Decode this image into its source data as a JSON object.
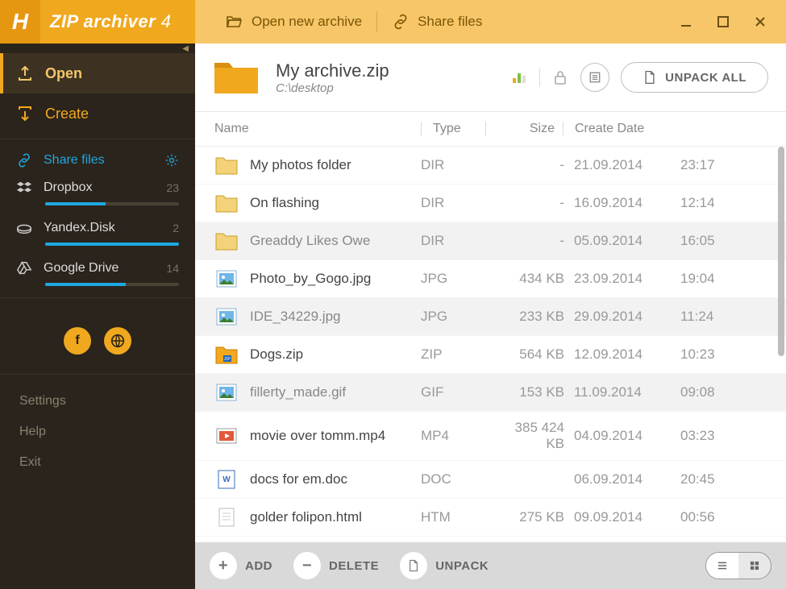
{
  "app": {
    "name": "ZIP archiver",
    "version": "4"
  },
  "toolbar": {
    "open_archive": "Open new archive",
    "share_files": "Share files"
  },
  "sidebar": {
    "open": "Open",
    "create": "Create",
    "share": "Share files",
    "clouds": [
      {
        "name": "Dropbox",
        "count": "23",
        "progress": 45
      },
      {
        "name": "Yandex.Disk",
        "count": "2",
        "progress": 100
      },
      {
        "name": "Google Drive",
        "count": "14",
        "progress": 60
      }
    ],
    "settings": "Settings",
    "help": "Help",
    "exit": "Exit"
  },
  "archive": {
    "name": "My archive.zip",
    "path": "C:\\desktop",
    "unpack_all": "UNPACK ALL"
  },
  "columns": {
    "name": "Name",
    "type": "Type",
    "size": "Size",
    "date": "Create Date"
  },
  "files": [
    {
      "icon": "folder",
      "name": "My photos folder",
      "type": "DIR",
      "size": "-",
      "date": "21.09.2014",
      "time": "23:17",
      "shade": false
    },
    {
      "icon": "folder",
      "name": "On flashing",
      "type": "DIR",
      "size": "-",
      "date": "16.09.2014",
      "time": "12:14",
      "shade": false
    },
    {
      "icon": "folder",
      "name": "Greaddy Likes Owe",
      "type": "DIR",
      "size": "-",
      "date": "05.09.2014",
      "time": "16:05",
      "shade": true
    },
    {
      "icon": "image",
      "name": "Photo_by_Gogo.jpg",
      "type": "JPG",
      "size": "434 KB",
      "date": "23.09.2014",
      "time": "19:04",
      "shade": false
    },
    {
      "icon": "image",
      "name": "IDE_34229.jpg",
      "type": "JPG",
      "size": "233 KB",
      "date": "29.09.2014",
      "time": "11:24",
      "shade": true
    },
    {
      "icon": "zip",
      "name": "Dogs.zip",
      "type": "ZIP",
      "size": "564 KB",
      "date": "12.09.2014",
      "time": "10:23",
      "shade": false
    },
    {
      "icon": "image",
      "name": "fillerty_made.gif",
      "type": "GIF",
      "size": "153 KB",
      "date": "11.09.2014",
      "time": "09:08",
      "shade": true
    },
    {
      "icon": "video",
      "name": "movie over tomm.mp4",
      "type": "MP4",
      "size": "385 424 KB",
      "date": "04.09.2014",
      "time": "03:23",
      "shade": false
    },
    {
      "icon": "doc",
      "name": "docs for em.doc",
      "type": "DOC",
      "size": "",
      "date": "06.09.2014",
      "time": "20:45",
      "shade": false
    },
    {
      "icon": "html",
      "name": "golder folipon.html",
      "type": "HTM",
      "size": "275 KB",
      "date": "09.09.2014",
      "time": "00:56",
      "shade": false
    }
  ],
  "bottom": {
    "add": "ADD",
    "delete": "DELETE",
    "unpack": "UNPACK"
  }
}
